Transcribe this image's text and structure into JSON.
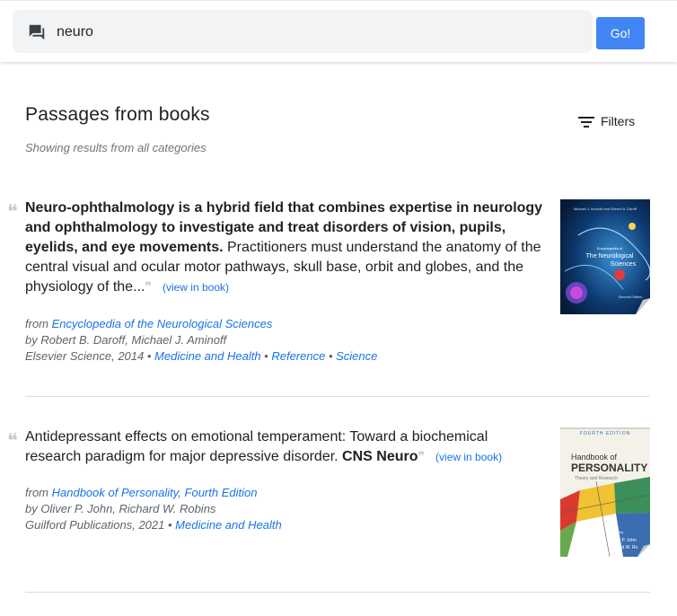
{
  "search": {
    "query": "neuro",
    "go_label": "Go!"
  },
  "page": {
    "title": "Passages from books",
    "filters_label": "Filters",
    "subtitle": "Showing results from all categories"
  },
  "results": [
    {
      "passage_bold": "Neuro-ophthalmology is a hybrid field that combines expertise in neurology and ophthalmology to investigate and treat disorders of vision, pupils, eyelids, and eye movements.",
      "passage_rest": " Practitioners must understand the anatomy of the central visual and ocular motor pathways, skull base, orbit and globes, and the physiology of the...",
      "view_link": "(view in book)",
      "from_prefix": "from ",
      "book_title": "Encyclopedia of the Neurological Sciences",
      "authors": "by Robert B. Daroff, Michael J. Aminoff",
      "publisher": "Elsevier Science, 2014",
      "categories": [
        "Medicine and Health",
        "Reference",
        "Science"
      ],
      "cover": {
        "top_text": "Michael J. Aminoff and Robert B. Daroff",
        "small_text": "Encyclopedia of",
        "title_lines": [
          "The Neurological",
          "Sciences"
        ],
        "edition": "Second Edition"
      }
    },
    {
      "passage_plain": "Antidepressant effects on emotional temperament: Toward a biochemical research paradigm for major depressive disorder. ",
      "passage_bold": "CNS Neuro",
      "view_link": "(view in book)",
      "from_prefix": "from ",
      "book_title": "Handbook of Personality, Fourth Edition",
      "authors": "by Oliver P. John, Richard W. Robins",
      "publisher": "Guilford Publications, 2021",
      "categories": [
        "Medicine and Health"
      ],
      "cover": {
        "edition": "FOURTH EDITION",
        "title_line1": "Handbook of",
        "title_line2": "PERSONALITY",
        "subtitle": "Theory and Research",
        "editors": [
          "Oliver P. John",
          "Richard W. Ro"
        ],
        "edited_by": "edited by"
      }
    }
  ],
  "colors": {
    "accent": "#4285f4",
    "link": "#1a73e8"
  }
}
